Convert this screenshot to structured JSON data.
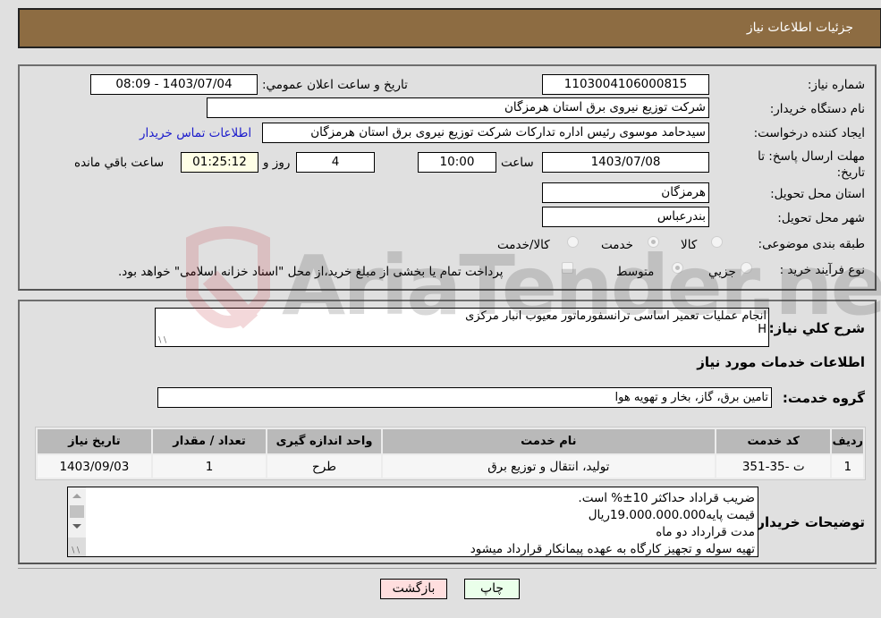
{
  "header": {
    "title": "جزئیات اطلاعات نیاز"
  },
  "form": {
    "need_number": {
      "label": "شماره نیاز:",
      "value": "1103004106000815"
    },
    "announce_datetime": {
      "label": "تاریخ و ساعت اعلان عمومي:",
      "value": "1403/07/04 - 08:09"
    },
    "buyer_org": {
      "label": "نام دستگاه خریدار:",
      "value": "شرکت توزیع نیروی برق استان هرمزگان"
    },
    "requester": {
      "label": "ایجاد کننده درخواست:",
      "value": "سیدحامد موسوی رئیس اداره تدارکات شرکت توزیع نیروی برق استان هرمزگان"
    },
    "buyer_contact_link": "اطلاعات تماس خریدار",
    "deadline": {
      "label": "مهلت ارسال پاسخ: تا تاریخ:",
      "date": "1403/07/08",
      "time_label": "ساعت",
      "time": "10:00",
      "days": "4",
      "days_label": "روز و",
      "remaining": "01:25:12",
      "remaining_label": "ساعت باقي مانده"
    },
    "province": {
      "label": "استان محل تحویل:",
      "value": "هرمزگان"
    },
    "city": {
      "label": "شهر محل تحویل:",
      "value": "بندرعباس"
    },
    "category": {
      "label": "طبقه بندی موضوعی:",
      "options": [
        "کالا",
        "خدمت",
        "کالا/خدمت"
      ],
      "selected": "خدمت"
    },
    "purchase_type": {
      "label": "نوع فرآیند خرید :",
      "options": [
        "جزيي",
        "متوسط"
      ],
      "selected": "متوسط",
      "treasury_note": "پرداخت تمام یا بخشی از مبلغ خرید،از محل \"اسناد خزانه اسلامی\" خواهد بود."
    }
  },
  "description": {
    "label": "شرح کلي نیاز:",
    "lines": [
      "انجام عملیات تعمیر اساسی  ترانسفورماتور معیوب انبار مرکزی",
      "H"
    ]
  },
  "services": {
    "section_title": "اطلاعات خدمات مورد نیاز",
    "group_label": "گروه خدمت:",
    "group_value": "تامین برق، گاز، بخار و تهویه هوا",
    "table": {
      "headers": [
        "ردیف",
        "کد خدمت",
        "نام خدمت",
        "واحد اندازه گیری",
        "تعداد / مقدار",
        "تاریخ نیاز"
      ],
      "rows": [
        [
          "1",
          "ت -35-351",
          "تولید، انتقال و توزیع برق",
          "طرح",
          "1",
          "1403/09/03"
        ]
      ]
    }
  },
  "buyer_notes": {
    "label": "توضیحات خریدار:",
    "lines": [
      "ضریب قراداد حداکثر 10±% است.",
      "قیمت پایه19.000.000.000ریال",
      "مدت قرارداد دو  ماه",
      "تهیه سوله و تجهیز کارگاه به عهده  پیمانکار قرارداد میشود"
    ]
  },
  "buttons": {
    "print": "چاپ",
    "back": "بازگشت"
  },
  "watermark": "AriaTender.neT",
  "colors": {
    "header_bg": "#8d6c42",
    "print_btn": "#eaffea",
    "back_btn": "#ffdede",
    "remaining_bg": "#ffffe6",
    "link": "#1a1acc"
  }
}
